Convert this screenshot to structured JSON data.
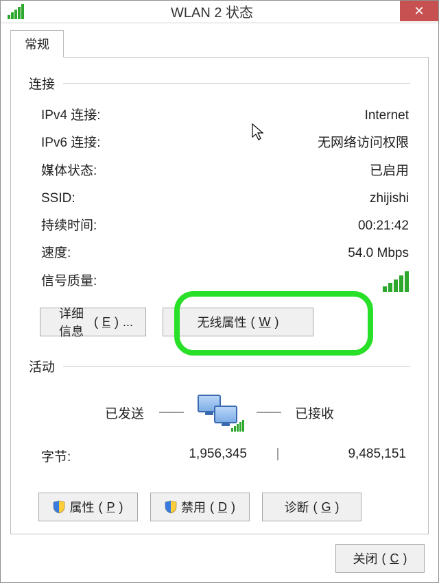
{
  "window": {
    "title": "WLAN 2 状态",
    "close_tooltip": "关闭"
  },
  "tabs": {
    "general": "常规"
  },
  "connection": {
    "group_label": "连接",
    "ipv4_label": "IPv4 连接:",
    "ipv4_value": "Internet",
    "ipv6_label": "IPv6 连接:",
    "ipv6_value": "无网络访问权限",
    "media_label": "媒体状态:",
    "media_value": "已启用",
    "ssid_label": "SSID:",
    "ssid_value": "zhijishi",
    "duration_label": "持续时间:",
    "duration_value": "00:21:42",
    "speed_label": "速度:",
    "speed_value": "54.0 Mbps",
    "signal_label": "信号质量:"
  },
  "buttons": {
    "details": "详细信息",
    "details_accel": "E",
    "details_suffix": "...",
    "wireless": "无线属性",
    "wireless_accel": "W",
    "properties": "属性",
    "properties_accel": "P",
    "disable": "禁用",
    "disable_accel": "D",
    "diagnose": "诊断",
    "diagnose_accel": "G",
    "close": "关闭",
    "close_accel": "C"
  },
  "activity": {
    "group_label": "活动",
    "sent_label": "已发送",
    "received_label": "已接收",
    "bytes_label": "字节:",
    "bytes_sent": "1,956,345",
    "bytes_received": "9,485,151"
  }
}
